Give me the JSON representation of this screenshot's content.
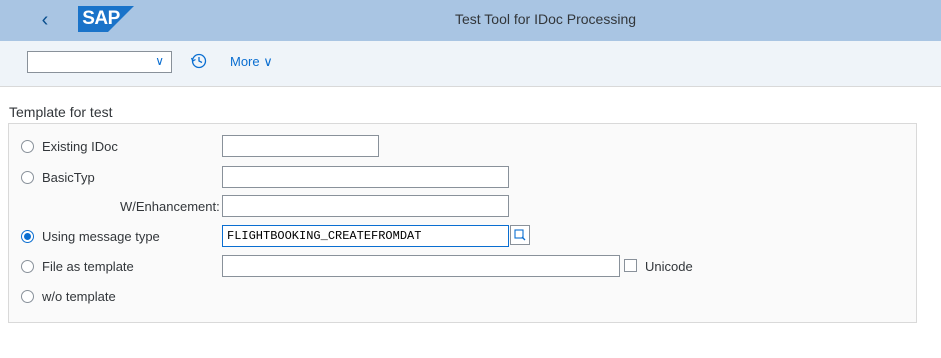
{
  "shell": {
    "logo": "SAP",
    "title": "Test Tool for IDoc Processing"
  },
  "toolbar": {
    "variant_value": "",
    "more_label": "More"
  },
  "section": {
    "title": "Template for test"
  },
  "form": {
    "existing_idoc": {
      "label": "Existing IDoc",
      "value": ""
    },
    "basic_type": {
      "label": "BasicTyp",
      "value": ""
    },
    "enhancement": {
      "label": "W/Enhancement:",
      "value": ""
    },
    "message_type": {
      "label": "Using message type",
      "value": "FLIGHTBOOKING_CREATEFROMDAT"
    },
    "file_template": {
      "label": "File as template",
      "value": ""
    },
    "unicode": {
      "label": "Unicode"
    },
    "no_template": {
      "label": "w/o template"
    }
  },
  "colors": {
    "shell_bg": "#a9c5e3",
    "toolbar_bg": "#eff4f9",
    "accent": "#0a6ed1"
  }
}
